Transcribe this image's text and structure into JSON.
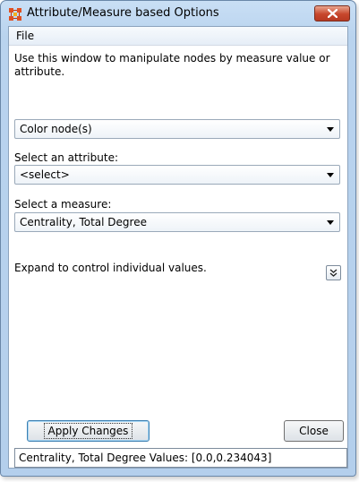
{
  "window": {
    "title": "Attribute/Measure based Options",
    "icon": "app-grid-icon",
    "close_icon": "close-icon"
  },
  "menubar": {
    "file_label": "File"
  },
  "description": "Use this window to manipulate nodes by measure value or attribute.",
  "action_select": {
    "value": "Color node(s)"
  },
  "attribute_select": {
    "label": "Select an attribute:",
    "value": "<select>"
  },
  "measure_select": {
    "label": "Select a measure:",
    "value": "Centrality, Total Degree"
  },
  "expand": {
    "label": "Expand to control individual values.",
    "icon": "double-chevron-down-icon"
  },
  "buttons": {
    "apply_label": "Apply Changes",
    "close_label": "Close"
  },
  "status": {
    "text": "Centrality, Total Degree Values: [0.0,0.234043]"
  },
  "colors": {
    "close_red": "#c7472c",
    "frame_blue": "#b9d3ee",
    "app_icon": "#e05020"
  }
}
